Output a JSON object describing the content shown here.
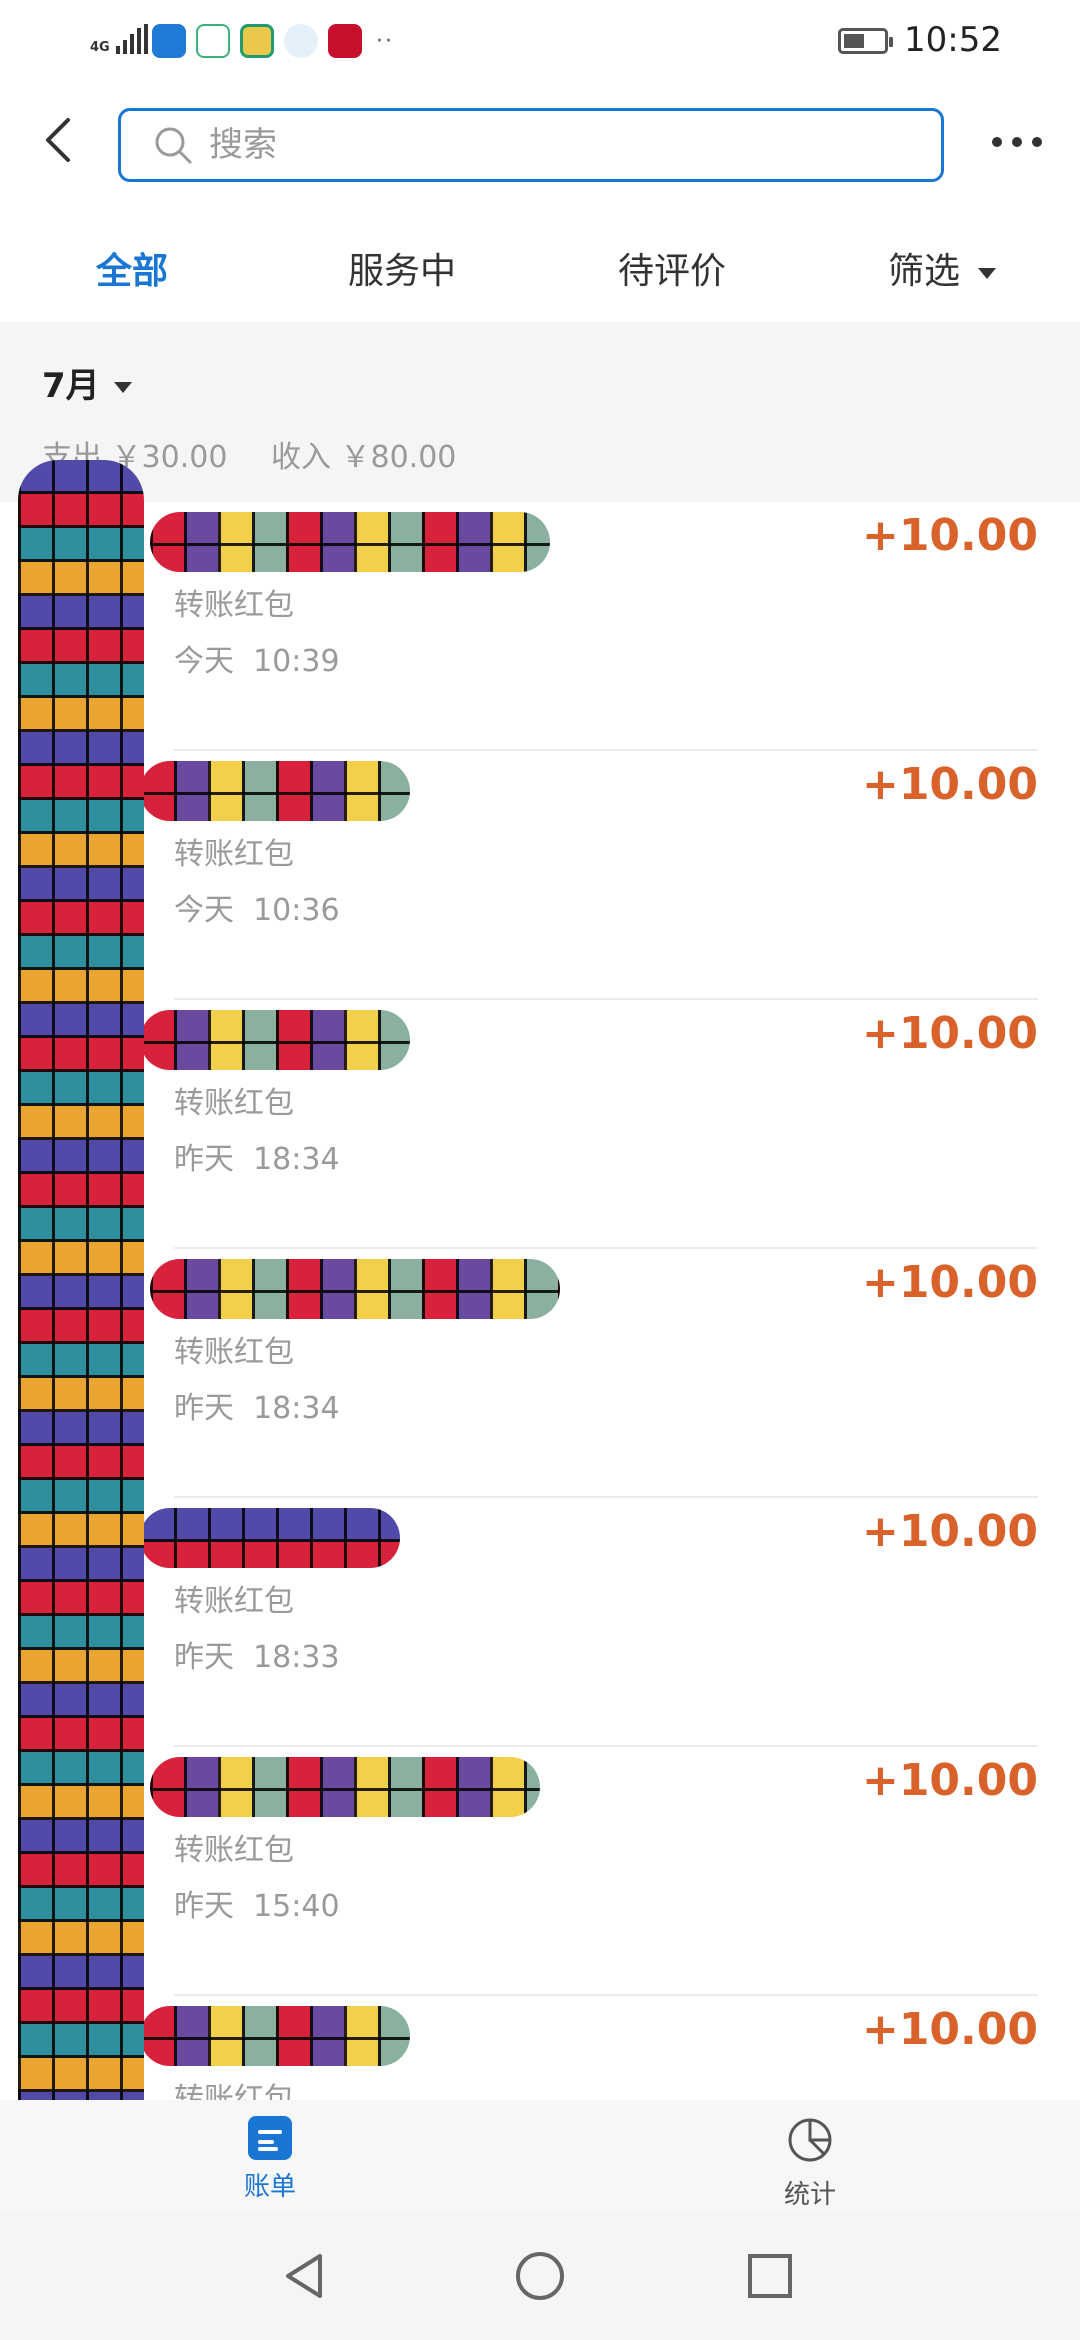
{
  "status_bar": {
    "network": "4G",
    "time": "10:52",
    "icons": [
      "wifi-hotspot-icon",
      "app-icon-green",
      "xianyu-icon",
      "browser-icon",
      "citic-icon"
    ],
    "more": "··"
  },
  "header": {
    "back_icon": "chevron-left-icon",
    "search": {
      "placeholder": "搜索",
      "value": ""
    },
    "more_icon": "more-horizontal-icon"
  },
  "tabs": [
    {
      "label": "全部",
      "active": true
    },
    {
      "label": "服务中",
      "active": false
    },
    {
      "label": "待评价",
      "active": false
    },
    {
      "label": "筛选",
      "active": false,
      "has_caret": true
    }
  ],
  "month": {
    "label": "7月",
    "expense": "支出 ￥30.00",
    "income": "收入 ￥80.00"
  },
  "transactions": [
    {
      "type": "转账红包",
      "date": "今天",
      "time": "10:39",
      "amount": "+10.00"
    },
    {
      "type": "转账红包",
      "date": "今天",
      "time": "10:36",
      "amount": "+10.00"
    },
    {
      "type": "转账红包",
      "date": "昨天",
      "time": "18:34",
      "amount": "+10.00"
    },
    {
      "type": "转账红包",
      "date": "昨天",
      "time": "18:34",
      "amount": "+10.00"
    },
    {
      "type": "转账红包",
      "date": "昨天",
      "time": "18:33",
      "amount": "+10.00"
    },
    {
      "type": "转账红包",
      "date": "昨天",
      "time": "15:40",
      "amount": "+10.00"
    },
    {
      "type": "转账红包",
      "date": "",
      "time": "",
      "amount": "+10.00"
    }
  ],
  "bottom_nav": [
    {
      "label": "账单",
      "icon": "bill-icon",
      "active": true
    },
    {
      "label": "统计",
      "icon": "pie-chart-icon",
      "active": false
    }
  ],
  "system_nav": [
    "back-triangle-icon",
    "home-circle-icon",
    "recents-square-icon"
  ],
  "colors": {
    "accent": "#1976d2",
    "amount": "#d9622b",
    "muted": "#9a9a9a"
  }
}
